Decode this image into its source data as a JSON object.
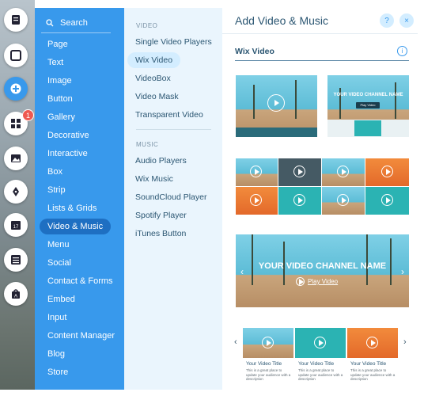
{
  "search": {
    "label": "Search"
  },
  "categories": [
    "Page",
    "Text",
    "Image",
    "Button",
    "Gallery",
    "Decorative",
    "Interactive",
    "Box",
    "Strip",
    "Lists & Grids",
    "Video & Music",
    "Menu",
    "Social",
    "Contact & Forms",
    "Embed",
    "Input",
    "Content Manager",
    "Blog",
    "Store"
  ],
  "rail": {
    "badge_count": "1"
  },
  "submenu": {
    "video_heading": "VIDEO",
    "video_items": [
      "Single Video Players",
      "Wix Video",
      "VideoBox",
      "Video Mask",
      "Transparent Video"
    ],
    "music_heading": "MUSIC",
    "music_items": [
      "Audio Players",
      "Wix Music",
      "SoundCloud Player",
      "Spotify Player",
      "iTunes Button"
    ]
  },
  "content": {
    "title": "Add Video & Music",
    "help_icon": "?",
    "close_icon": "×",
    "section_title": "Wix Video",
    "info_icon": "i",
    "thumb2_caption": "YOUR VIDEO CHANNEL NAME",
    "thumb2_button": "Play Video",
    "banner_caption": "YOUR VIDEO CHANNEL NAME",
    "banner_link": "Play Video",
    "card_title": "Your Video Title",
    "card_desc": "This is a great place to update your audience with a description"
  },
  "colors": {
    "accent": "#3899ec",
    "selected": "#1e6fc2",
    "submenu_bg": "#eaf5fd"
  }
}
